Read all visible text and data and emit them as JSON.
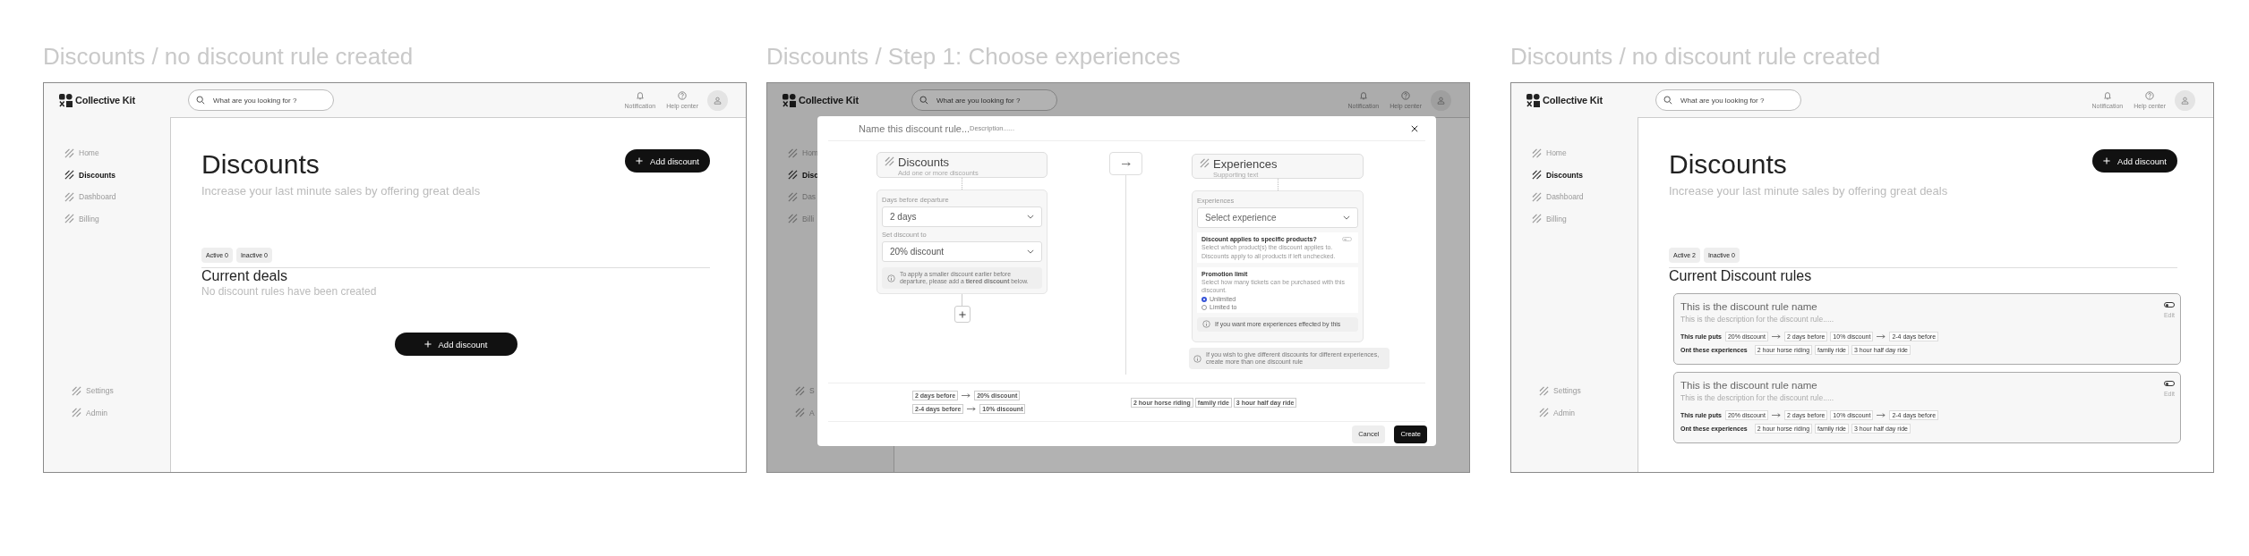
{
  "frames": [
    {
      "kind": "list",
      "caption": "Discounts / no discount rule created",
      "app": {
        "brand": "Collective Kit",
        "search": {
          "placeholder": "What are you looking for ?"
        },
        "actions": [
          {
            "kind": "bell",
            "label": "Notification"
          },
          {
            "kind": "help",
            "label": "Help center"
          }
        ],
        "nav": [
          {
            "label": "Home",
            "selected": false
          },
          {
            "label": "Discounts",
            "selected": true
          },
          {
            "label": "Dashboard",
            "selected": false
          },
          {
            "label": "Billing",
            "selected": false
          }
        ],
        "nav_bottom": [
          "Settings",
          "Admin"
        ]
      },
      "page": {
        "title": "Discounts",
        "subtitle": "Increase your last minute sales by offering great deals",
        "add_button": "Add discount",
        "filters": [
          "Active 0",
          "Inactive 0"
        ],
        "section_title": "Current deals",
        "empty_message": "No discount rules have been created",
        "empty_button": "Add discount"
      }
    },
    {
      "kind": "modal",
      "caption": "Discounts / Step 1: Choose experiences",
      "app": {
        "brand": "Collective Kit",
        "search": {
          "placeholder": "What are you looking for ?"
        },
        "actions": [
          {
            "kind": "bell",
            "label": "Notification"
          },
          {
            "kind": "help",
            "label": "Help center"
          }
        ],
        "nav": [
          {
            "label": "Hom",
            "selected": false
          },
          {
            "label": "Disc",
            "selected": true
          },
          {
            "label": "Das",
            "selected": false
          },
          {
            "label": "Billi",
            "selected": false
          }
        ],
        "nav_bottom": [
          "S",
          "A"
        ]
      },
      "modal": {
        "name": {
          "placeholder": "Name this discount rule..."
        },
        "description": {
          "placeholder": "Description......"
        },
        "discounts": {
          "title": "Discounts",
          "subtitle": "Add one or more discounts",
          "fields": [
            {
              "label": "Days before departure",
              "value": "2 days"
            },
            {
              "label": "Set discount to",
              "value": "20% discount"
            }
          ],
          "info": "To apply a smaller discount earlier before departure, please add a **tiered discount** below."
        },
        "experiences": {
          "title": "Experiences",
          "subtitle": "Supporting text",
          "field": {
            "label": "Experiences",
            "placeholder": "Select experience"
          },
          "specific": {
            "title": "Discount applies to specific products?",
            "on": false,
            "lines": [
              "Select which product(s) the discount applies to.",
              "Discounts apply to all products if left unchecked."
            ]
          },
          "limit": {
            "title": "Promotion limit",
            "hint": "Select how many tickets can be purchased with this discount.",
            "options": [
              {
                "label": "Unlimited",
                "selected": true
              },
              {
                "label": "Limited to",
                "selected": false
              }
            ]
          },
          "info": "If you want more experiences effected by this"
        },
        "note": "If you wish to give different discounts for different experiences, create more than one discount rule",
        "summary": {
          "pairs": [
            [
              "2 days before",
              "20% discount"
            ],
            [
              "2-4 days before",
              "10% discount"
            ]
          ],
          "experiences": [
            "2 hour horse riding",
            "family ride",
            "3 hour half day ride"
          ]
        },
        "buttons": [
          {
            "label": "Cancel",
            "kind": "secondary"
          },
          {
            "label": "Create",
            "kind": "primary"
          }
        ]
      }
    },
    {
      "kind": "list",
      "caption": "Discounts / no discount rule created",
      "app": {
        "brand": "Collective Kit",
        "search": {
          "placeholder": "What are you looking for ?"
        },
        "actions": [
          {
            "kind": "bell",
            "label": "Notification"
          },
          {
            "kind": "help",
            "label": "Help center"
          }
        ],
        "nav": [
          {
            "label": "Home",
            "selected": false
          },
          {
            "label": "Discounts",
            "selected": true
          },
          {
            "label": "Dashboard",
            "selected": false
          },
          {
            "label": "Billing",
            "selected": false
          }
        ],
        "nav_bottom": [
          "Settings",
          "Admin"
        ]
      },
      "page": {
        "title": "Discounts",
        "subtitle": "Increase your last minute sales by offering great deals",
        "add_button": "Add discount",
        "filters": [
          "Active 2",
          "Inactive 0"
        ],
        "section_title": "Current Discount rules",
        "rules": [
          {
            "name": "This is the discount rule name",
            "description": "This is the description for the discount rule.....",
            "on": false,
            "edit": "Edit",
            "puts_label": "This rule puts",
            "pairs": [
              [
                "20% discount",
                "2 days before"
              ],
              [
                "10% discount",
                "2-4 days before"
              ]
            ],
            "experiences_label": "Ont these experiences",
            "experiences": [
              "2 hour horse riding",
              "family ride",
              "3 hour half day ride"
            ]
          },
          {
            "name": "This is the discount rule name",
            "description": "This is the description for the discount rule.....",
            "on": false,
            "edit": "Edit",
            "puts_label": "This rule puts",
            "pairs": [
              [
                "20% discount",
                "2 days before"
              ],
              [
                "10% discount",
                "2-4 days before"
              ]
            ],
            "experiences_label": "Ont these experiences",
            "experiences": [
              "2 hour horse riding",
              "family ride",
              "3 hour half day ride"
            ]
          }
        ]
      }
    }
  ]
}
